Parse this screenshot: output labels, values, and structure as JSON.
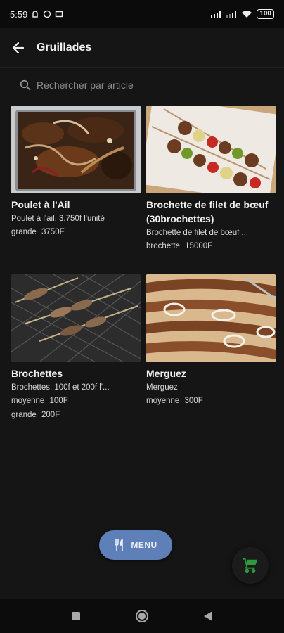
{
  "status_bar": {
    "time": "5:59",
    "battery": "100"
  },
  "app_bar": {
    "title": "Gruillades",
    "back_icon": "arrow-left-icon"
  },
  "search": {
    "placeholder": "Rechercher par article",
    "icon": "search-icon"
  },
  "items": [
    {
      "title": "Poulet à l'Ail",
      "description": "Poulet à l'ail, 3.750f l'unité",
      "prices": [
        {
          "size": "grande",
          "price": "3750F"
        }
      ]
    },
    {
      "title": "Brochette de filet de bœuf (30brochettes)",
      "description": "Brochette de filet de bœuf ...",
      "prices": [
        {
          "size": "brochette",
          "price": "15000F"
        }
      ]
    },
    {
      "title": "Brochettes",
      "description": "Brochettes, 100f et 200f l'...",
      "prices": [
        {
          "size": "moyenne",
          "price": "100F"
        },
        {
          "size": "grande",
          "price": "200F"
        }
      ]
    },
    {
      "title": "Merguez",
      "description": "Merguez",
      "prices": [
        {
          "size": "moyenne",
          "price": "300F"
        }
      ]
    }
  ],
  "menu_button": {
    "label": "MENU",
    "icon": "fork-knife-icon"
  },
  "cart_button": {
    "icon": "cart-icon"
  },
  "colors": {
    "background": "#151515",
    "menu_button": "#5f7fb8",
    "cart_icon": "#2e9a3b"
  }
}
